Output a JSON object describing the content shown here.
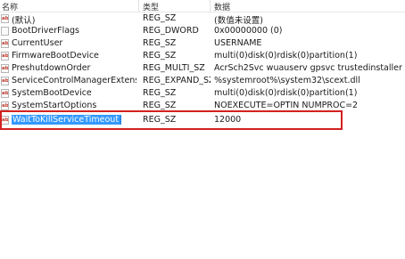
{
  "columns": {
    "name": "名称",
    "type": "类型",
    "data": "数据"
  },
  "icon_label": "ab",
  "rows": [
    {
      "name": "(默认)",
      "type": "REG_SZ",
      "data": "(数值未设置)"
    },
    {
      "name": "BootDriverFlags",
      "type": "REG_DWORD",
      "data": "0x00000000 (0)"
    },
    {
      "name": "CurrentUser",
      "type": "REG_SZ",
      "data": "USERNAME"
    },
    {
      "name": "FirmwareBootDevice",
      "type": "REG_SZ",
      "data": "multi(0)disk(0)rdisk(0)partition(1)"
    },
    {
      "name": "PreshutdownOrder",
      "type": "REG_MULTI_SZ",
      "data": "AcrSch2Svc wuauserv gpsvc trustedinstaller"
    },
    {
      "name": "ServiceControlManagerExtension",
      "type": "REG_EXPAND_SZ",
      "data": "%systemroot%\\system32\\scext.dll"
    },
    {
      "name": "SystemBootDevice",
      "type": "REG_SZ",
      "data": "multi(0)disk(0)rdisk(0)partition(1)"
    },
    {
      "name": "SystemStartOptions",
      "type": "REG_SZ",
      "data": "NOEXECUTE=OPTIN  NUMPROC=2"
    },
    {
      "name": "WaitToKillServiceTimeout",
      "type": "REG_SZ",
      "data": "12000"
    }
  ],
  "colors": {
    "selection": "#3399ff",
    "highlight_box": "#d32020"
  }
}
